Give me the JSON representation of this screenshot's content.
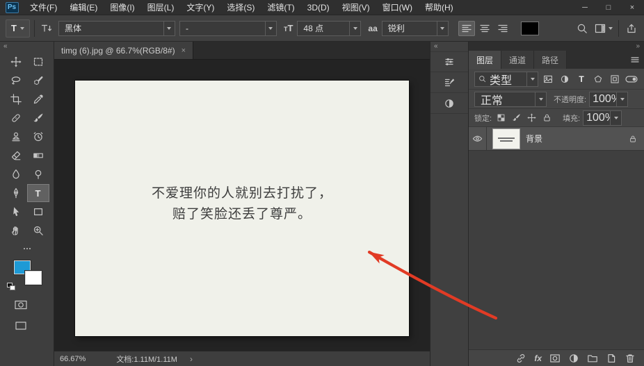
{
  "window": {
    "logo_label": "Ps",
    "minimize_glyph": "─",
    "maximize_glyph": "□",
    "close_glyph": "×"
  },
  "menubar": {
    "items": [
      {
        "label": "文件(F)"
      },
      {
        "label": "编辑(E)"
      },
      {
        "label": "图像(I)"
      },
      {
        "label": "图层(L)"
      },
      {
        "label": "文字(Y)"
      },
      {
        "label": "选择(S)"
      },
      {
        "label": "滤镜(T)"
      },
      {
        "label": "3D(D)"
      },
      {
        "label": "视图(V)"
      },
      {
        "label": "窗口(W)"
      },
      {
        "label": "帮助(H)"
      }
    ]
  },
  "options": {
    "type_tool_glyph": "T",
    "font_family": "黑体",
    "font_style": "-",
    "size_glyph": "T",
    "font_size": "48 点",
    "aa_glyph": "aa",
    "anti_alias": "锐利",
    "text_color": "#000000"
  },
  "toolbar": {
    "type_tool_glyph": "T",
    "foreground_color": "#1e9ad6",
    "background_color": "#ffffff"
  },
  "document": {
    "tab_title": "timg (6).jpg @ 66.7%(RGB/8#)",
    "close_glyph": "×",
    "image_text_line1": "不爱理你的人就别去打扰了，",
    "image_text_line2": "赔了笑脸还丢了尊严。",
    "arrow_color": "#e13b25"
  },
  "panels": {
    "tabs": [
      {
        "label": "图层"
      },
      {
        "label": "通道"
      },
      {
        "label": "路径"
      }
    ],
    "filter_label": "类型",
    "type_glyph": "T",
    "blend_mode": "正常",
    "opacity_label": "不透明度:",
    "opacity_value": "100%",
    "lock_label": "锁定:",
    "fill_label": "填充:",
    "fill_value": "100%",
    "layer_name": "背景",
    "fx_glyph": "fx"
  },
  "statusbar": {
    "zoom": "66.67%",
    "doc_info": "文档:1.11M/1.11M",
    "chevron_glyph": "›"
  },
  "glyphs": {
    "collapse_left": "«",
    "collapse_right": "»"
  }
}
